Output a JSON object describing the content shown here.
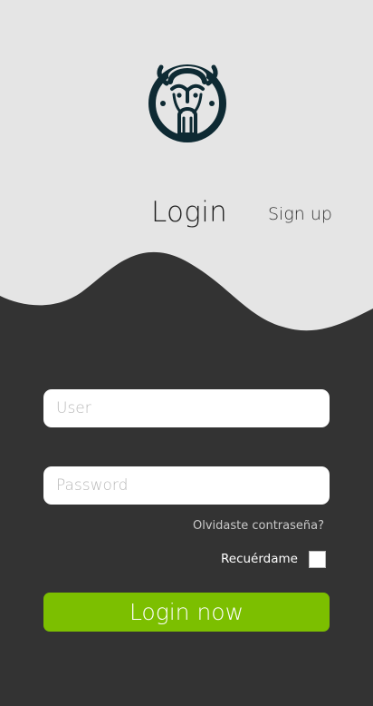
{
  "colors": {
    "top_background": "#e5e5e5",
    "bottom_background": "#333333",
    "logo": "#0e2a33",
    "accent_button": "#7cbf00",
    "input_background": "#ffffff"
  },
  "header": {
    "logo_icon": "tribal-mask-icon",
    "tabs": {
      "login": "Login",
      "signup": "Sign up"
    }
  },
  "form": {
    "user": {
      "placeholder": "User",
      "value": ""
    },
    "password": {
      "placeholder": "Password",
      "value": ""
    },
    "forgot_label": "Olvidaste contraseña?",
    "remember_label": "Recuérdame",
    "remember_checked": false,
    "submit_label": "Login now"
  }
}
